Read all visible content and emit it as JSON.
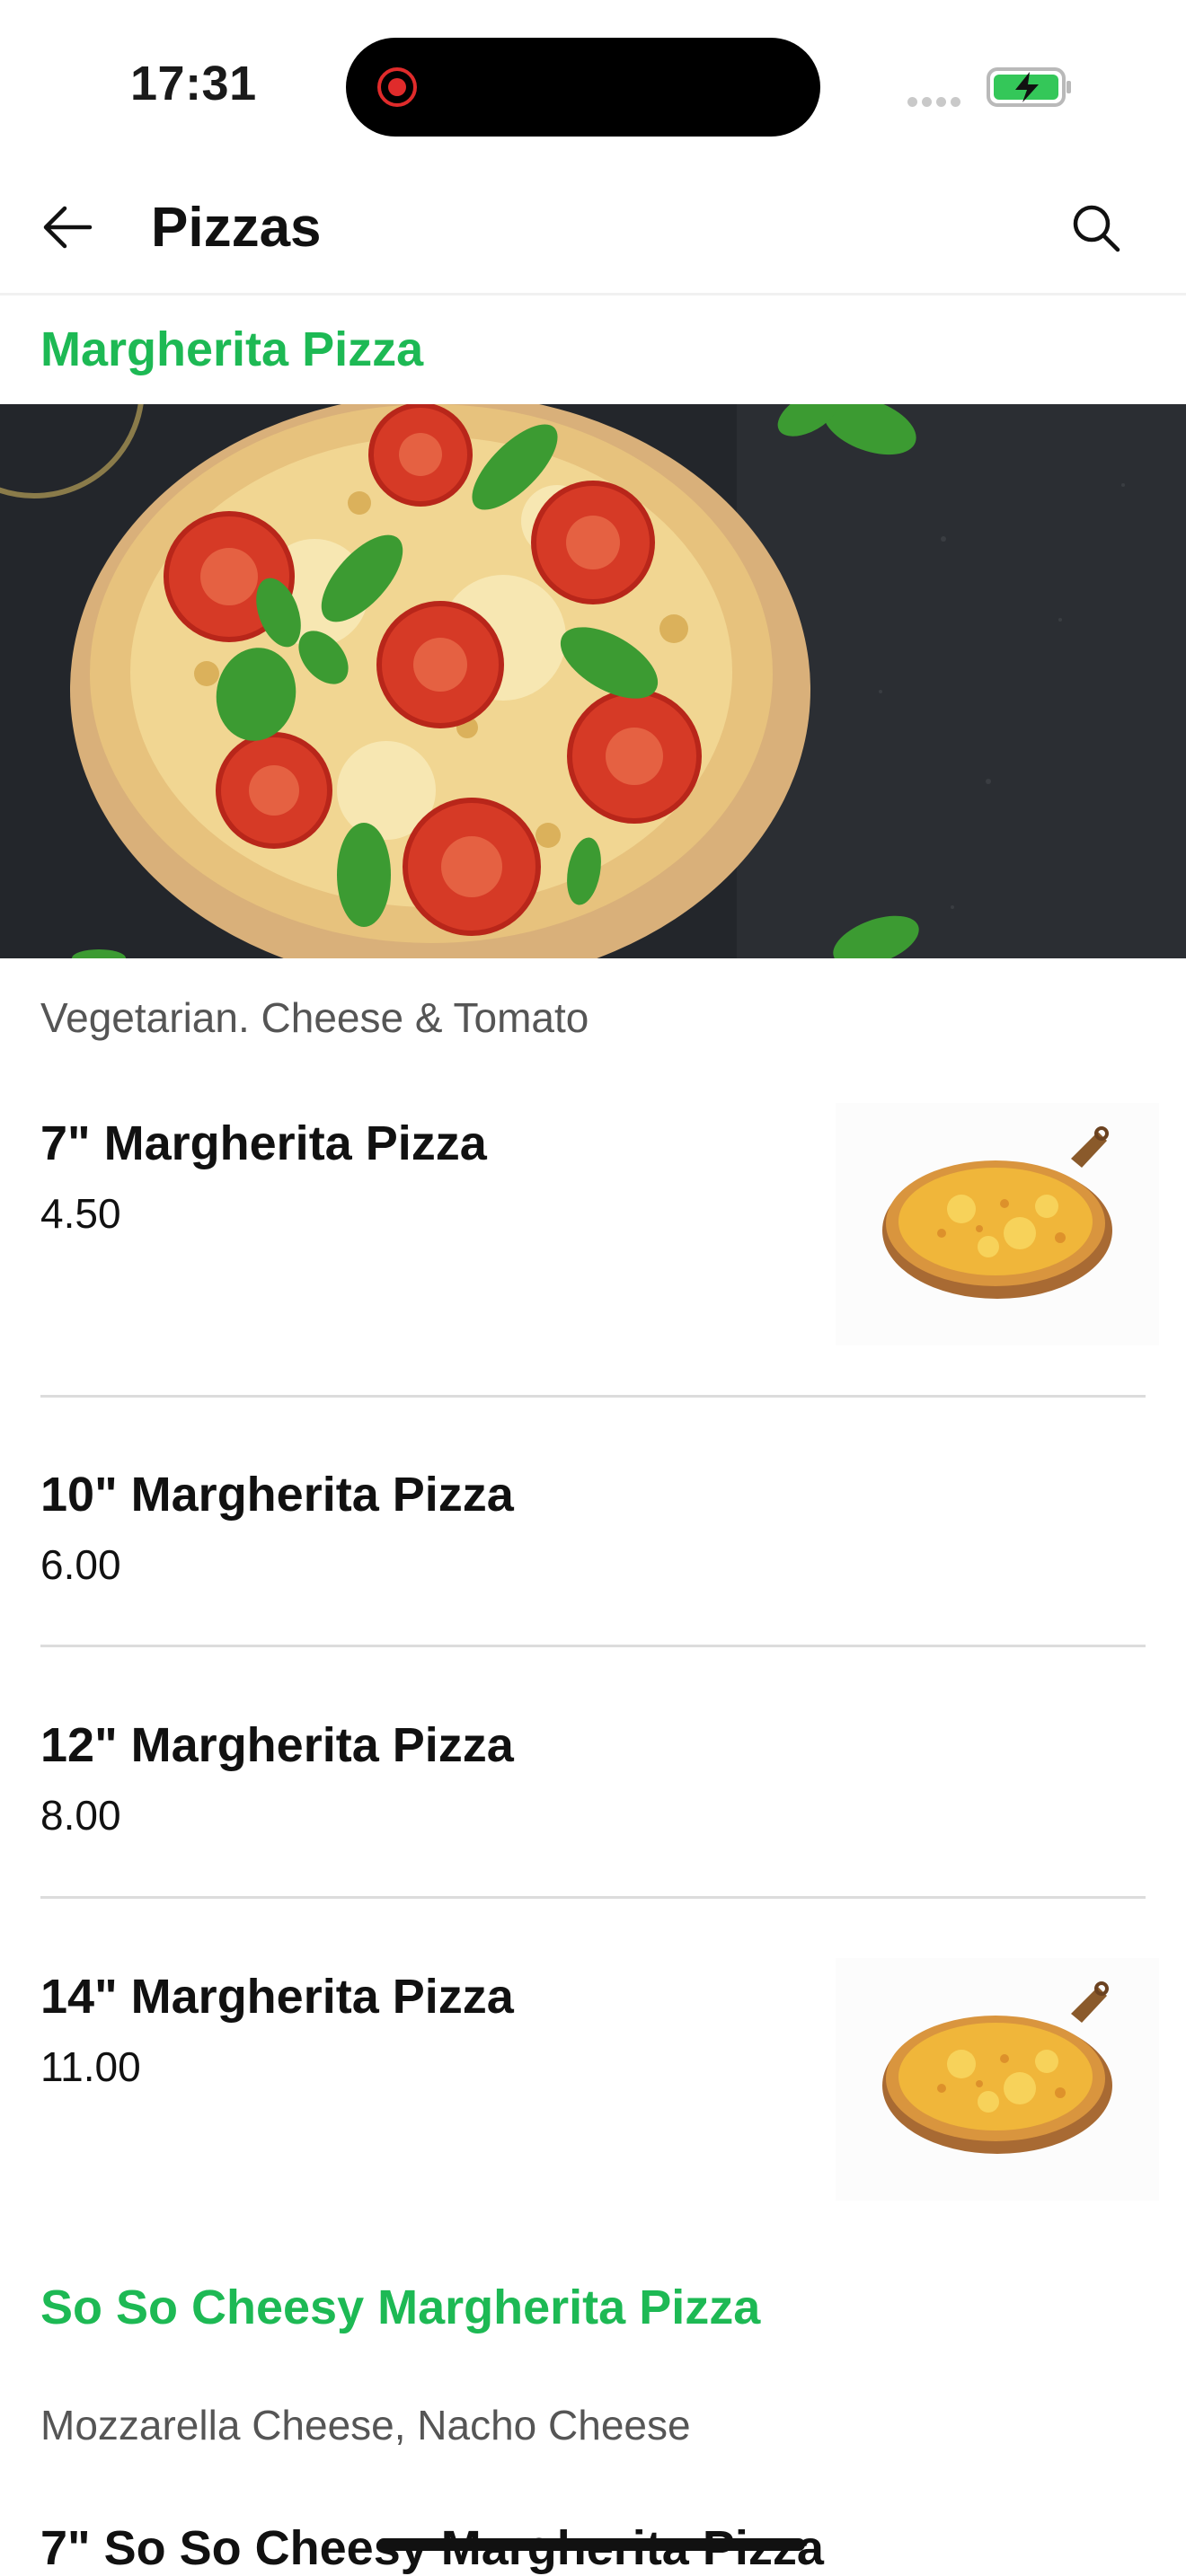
{
  "status_bar": {
    "time": "17:31",
    "battery_color": "#34c759"
  },
  "nav": {
    "title": "Pizzas",
    "back_icon": "arrow-left-icon",
    "search_icon": "search-icon"
  },
  "sections": [
    {
      "title": "Margherita Pizza",
      "description": "Vegetarian. Cheese & Tomato",
      "items": [
        {
          "name": "7\" Margherita Pizza",
          "price": "4.50"
        },
        {
          "name": "10\" Margherita Pizza",
          "price": "6.00"
        },
        {
          "name": "12\" Margherita Pizza",
          "price": "8.00"
        },
        {
          "name": "14\" Margherita Pizza",
          "price": "11.00"
        }
      ]
    },
    {
      "title": "So So Cheesy Margherita Pizza",
      "description": "Mozzarella Cheese, Nacho Cheese",
      "items": [
        {
          "name": "7\" So So Cheesy Margherita Pizza"
        }
      ]
    }
  ],
  "colors": {
    "accent": "#1db954",
    "text": "#111111",
    "muted": "#555555"
  }
}
